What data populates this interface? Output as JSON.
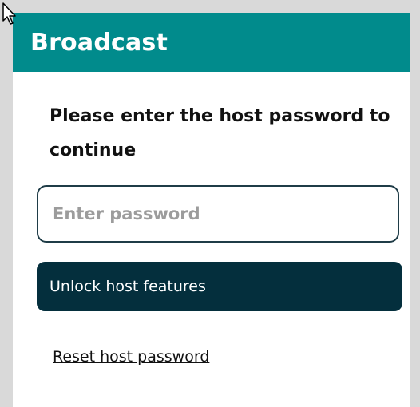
{
  "header": {
    "title": "Broadcast"
  },
  "prompt": {
    "text": "Please enter the host password to continue"
  },
  "password_input": {
    "value": "",
    "placeholder": "Enter password"
  },
  "unlock_button": {
    "label": "Unlock host features"
  },
  "reset_link": {
    "label": "Reset host password"
  },
  "colors": {
    "header_bg": "#018b8c",
    "button_bg": "#042f3d",
    "input_border": "#1f3c47"
  },
  "icons": {
    "cursor": "mouse-pointer-icon"
  }
}
